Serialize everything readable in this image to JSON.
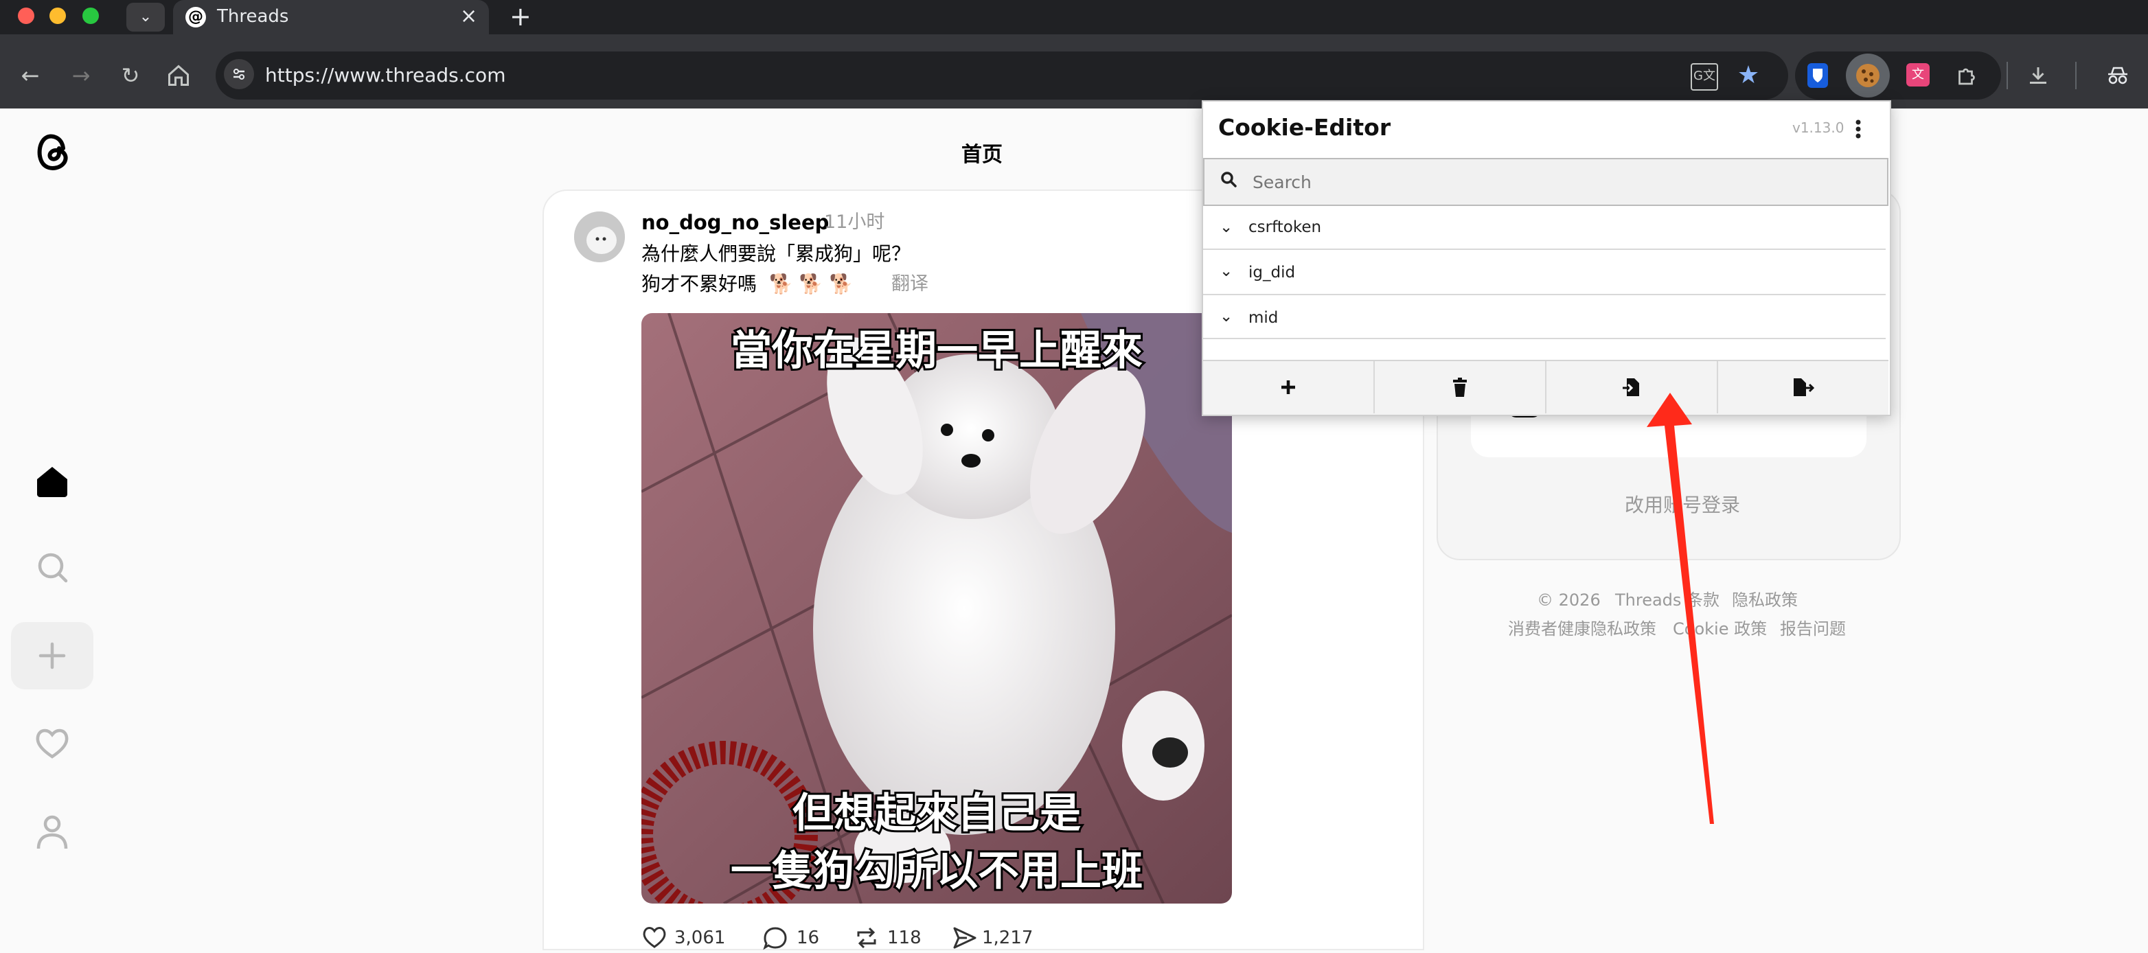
{
  "browser": {
    "tab_title": "Threads",
    "url": "https://www.threads.com",
    "new_tab": "+",
    "close_tab": "×"
  },
  "page": {
    "header_title": "首页"
  },
  "post": {
    "username": "no_dog_no_sleep",
    "time": "11小时",
    "line1": "為什麼人們要說「累成狗」呢？",
    "line2": "狗才不累好嗎",
    "emojis": "🐕 🐕 🐕",
    "translate": "翻译",
    "caption_top": "當你在星期一早上醒來",
    "caption_bottom_1": "但想起來自己是",
    "caption_bottom_2": "一隻狗勾所以不用上班",
    "likes": "3,061",
    "comments": "16",
    "reposts": "118",
    "shares": "1,217"
  },
  "sidebar_login": {
    "alt_login": "改用账号登录"
  },
  "footer": {
    "copyright": "© 2026",
    "terms": "Threads 条款",
    "privacy": "隐私政策",
    "health_privacy": "消费者健康隐私政策",
    "cookie": "Cookie 政策",
    "report": "报告问题"
  },
  "cookie_editor": {
    "title": "Cookie-Editor",
    "version": "v1.13.0",
    "search_placeholder": "Search",
    "cookies": [
      "csrftoken",
      "ig_did",
      "mid"
    ]
  },
  "colors": {
    "annotation_arrow": "#ff2a1a",
    "tab_active": "#35363a",
    "chrome_dark": "#202124"
  }
}
